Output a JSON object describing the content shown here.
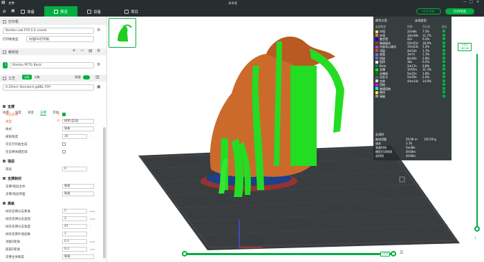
{
  "window": {
    "title": "未命名",
    "file_menu": "文件"
  },
  "tabs": [
    {
      "label": "准备"
    },
    {
      "label": "预览"
    },
    {
      "label": "设备"
    },
    {
      "label": "项目"
    }
  ],
  "actions": {
    "slice_all": "切片单盘",
    "print": "打印单盘"
  },
  "printer": {
    "section": "打印机",
    "name": "Bambu Lab P1P 0.4 nozzle",
    "plate_label": "打印板类型",
    "plate_value": "纹理PEI打印板"
  },
  "filament": {
    "section": "耗材丝",
    "slot_num": "1",
    "name": "Bambu PETG Basic"
  },
  "process": {
    "section": "工艺",
    "global": "全局",
    "object": "对象",
    "advanced": "高级",
    "profile": "0.20mm Standard @BBL P1P",
    "subtabs": [
      "质量",
      "强度",
      "速度",
      "支撑",
      "其他"
    ]
  },
  "support": {
    "header": "支撑",
    "rows": [
      {
        "label": "开启支撑",
        "type": "check",
        "on": true
      },
      {
        "label": "类型",
        "value": "树状(自动)"
      },
      {
        "label": "样式",
        "value": "缺省"
      },
      {
        "label": "阈值角度",
        "value": "30",
        "unit": "°"
      },
      {
        "label": "仅在打印板生成",
        "type": "check",
        "on": false
      },
      {
        "label": "仅支撑关键区域",
        "type": "check",
        "on": false
      }
    ]
  },
  "raft": {
    "header": "筏层",
    "rows": [
      {
        "label": "筏层",
        "value": "0"
      }
    ]
  },
  "support_filament": {
    "header": "支撑耗材",
    "rows": [
      {
        "label": "支撑/筏层主体",
        "value": "缺省"
      },
      {
        "label": "支撑/筏层界面",
        "value": "缺省"
      }
    ]
  },
  "advanced": {
    "header": "高级",
    "rows": [
      {
        "label": "树状支撑分支距离",
        "value": "5",
        "unit": "mm"
      },
      {
        "label": "树状支撑分支直径",
        "value": "2",
        "unit": "mm"
      },
      {
        "label": "树状支撑分支角度",
        "value": "45",
        "unit": "°"
      },
      {
        "label": "树状支撑外墙层数",
        "value": "1"
      },
      {
        "label": "顶部Z距离",
        "value": "0.2",
        "unit": "mm"
      },
      {
        "label": "底部Z距离",
        "value": "0.2",
        "unit": "mm"
      },
      {
        "label": "支撑主体图案",
        "value": "缺省"
      }
    ]
  },
  "stats": {
    "title": "颜色方案",
    "scheme": "走线类型",
    "headers": [
      "走线类型",
      "时间",
      "百分比",
      "显示"
    ],
    "rows": [
      {
        "name": "内墙",
        "time": "22m8s",
        "pct": "7.5%",
        "color": "#ffe74b"
      },
      {
        "name": "外墙",
        "time": "34m39s",
        "pct": "11.7%",
        "color": "#ff7d38"
      },
      {
        "name": "悬空墙",
        "time": "42s",
        "pct": "0.2%",
        "color": "#0000ff"
      },
      {
        "name": "稀疏填充",
        "time": "55m55s",
        "pct": "18.9%",
        "color": "#b03029"
      },
      {
        "name": "内部实心填充",
        "time": "15m23s",
        "pct": "5.2%",
        "color": "#9654cc"
      },
      {
        "name": "顶面",
        "time": "4m53s",
        "pct": "1.7%",
        "color": "#f0412d"
      },
      {
        "name": "底面",
        "time": "3m7s",
        "pct": "1.1%",
        "color": "#7b6bff"
      },
      {
        "name": "桥接",
        "time": "8m20s",
        "pct": "2.8%",
        "color": "#4d80ba"
      },
      {
        "name": "搭桥",
        "time": "36s",
        "pct": "0.2%",
        "color": "#ffffff"
      },
      {
        "name": "Brim",
        "time": "2m17s",
        "pct": "0.8%",
        "color": "#00875a"
      },
      {
        "name": "支撑",
        "time": "1h55m",
        "pct": "31.3%",
        "color": "#00ff00"
      },
      {
        "name": "支撑面",
        "time": "5m22s",
        "pct": "1.8%",
        "color": "#008000"
      },
      {
        "name": "自定义",
        "time": "5m59s",
        "pct": "2.0%",
        "color": "#5e5e5e"
      },
      {
        "name": "空移",
        "time": "44m14s",
        "pct": "14.9%",
        "color": "#dddddd"
      },
      {
        "name": "回抽",
        "time": "",
        "pct": "",
        "color": "#ff00ff"
      },
      {
        "name": "装填回抽",
        "time": "",
        "pct": "",
        "color": "#00ffff"
      },
      {
        "name": "擦拭",
        "time": "",
        "pct": "",
        "color": "#ffff00"
      },
      {
        "name": "接缝",
        "time": "",
        "pct": "",
        "color": "#999999"
      }
    ],
    "estimate_title": "总用时",
    "estimates": [
      {
        "label": "耗材用量",
        "v1": "50.09 m",
        "v2": "150.59 g"
      },
      {
        "label": "成本",
        "v1": "3.76",
        "v2": ""
      },
      {
        "label": "准备时间",
        "v1": "5m48s",
        "v2": ""
      },
      {
        "label": "模型打印时间",
        "v1": "4h58m",
        "v2": ""
      },
      {
        "label": "总时间",
        "v1": "4h58m",
        "v2": ""
      }
    ]
  },
  "layer_slider": {
    "top_layer": "1320",
    "top_height": "189.60",
    "bottom_layer": "1"
  },
  "move_slider": {
    "value": "1034"
  },
  "colors": {
    "accent": "#00ae42",
    "topbar": "#262e30",
    "model": "#cc6a2c",
    "support": "#22dd22"
  }
}
